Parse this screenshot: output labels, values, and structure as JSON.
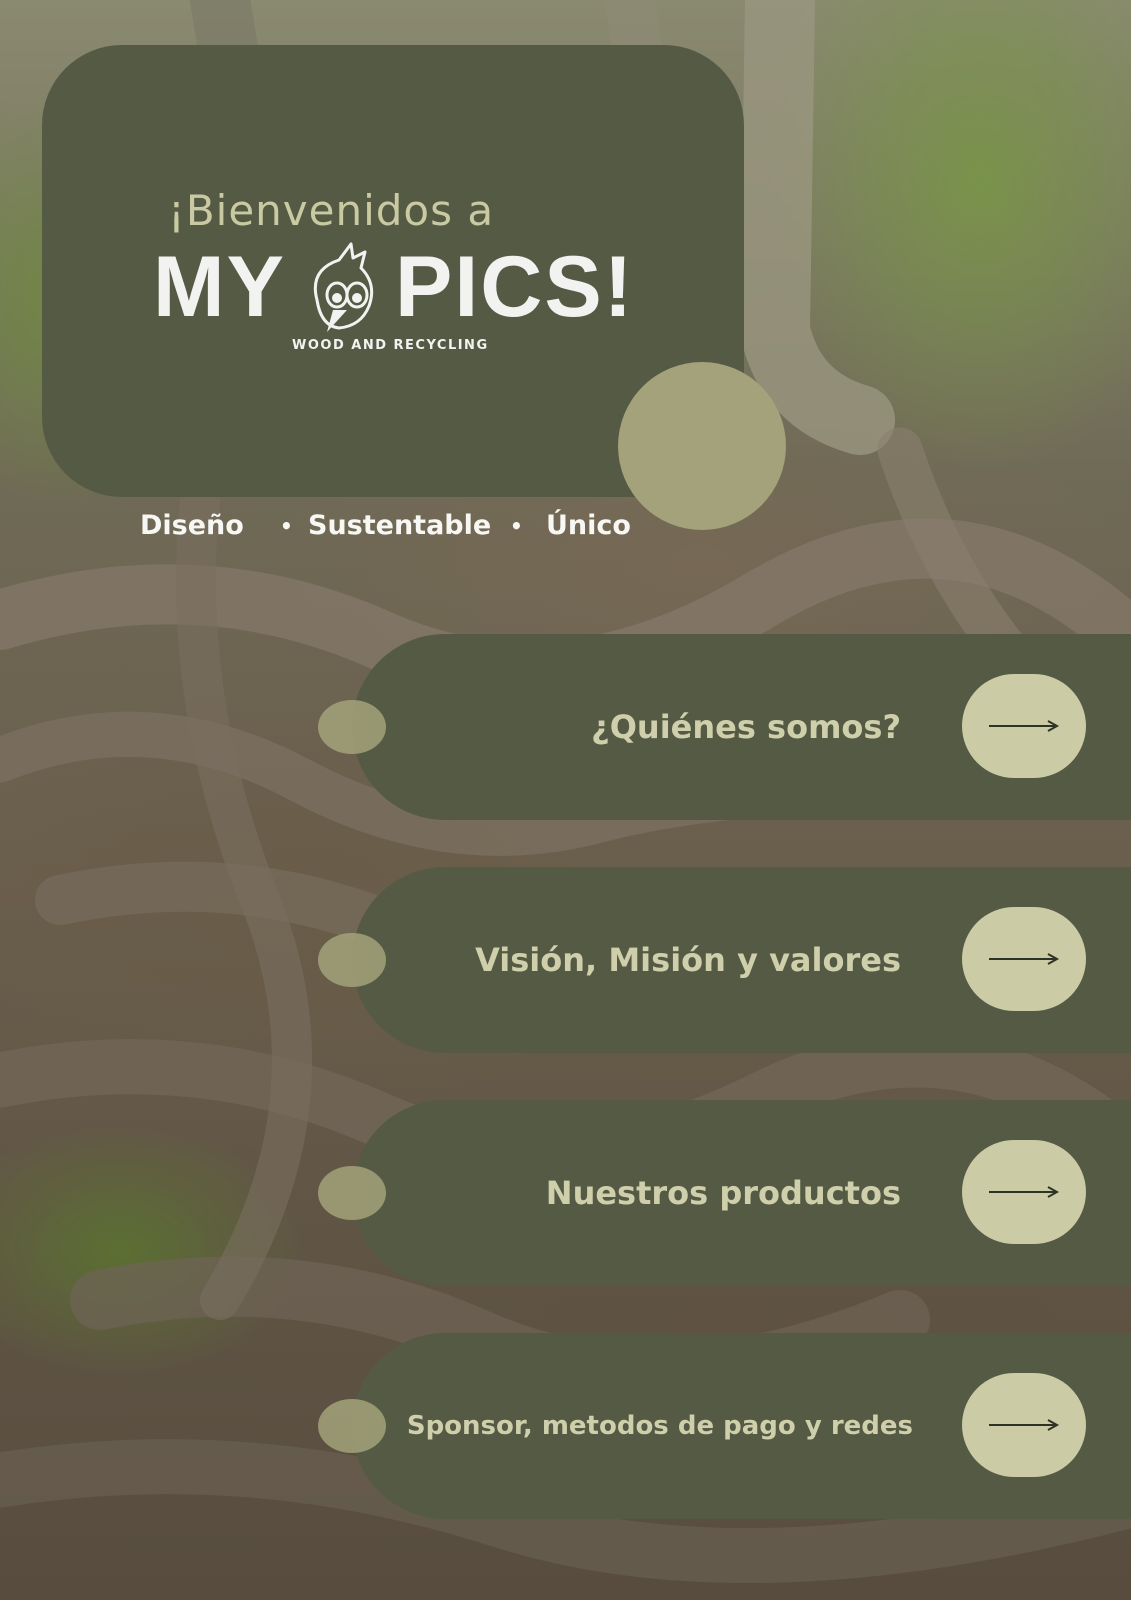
{
  "hero": {
    "welcome": "¡Bienvenidos a",
    "brand_left": "MY",
    "brand_right": "PICS!",
    "tagline": "WOOD AND RECYCLING"
  },
  "values": {
    "item1": "Diseño",
    "sep1": "•",
    "item2": "Sustentable",
    "sep2": "•",
    "item3": "Único"
  },
  "nav": [
    {
      "label": "¿Quiénes somos?",
      "icon": "arrow-right-icon"
    },
    {
      "label": "Visión, Misión y valores",
      "icon": "arrow-right-icon"
    },
    {
      "label": "Nuestros productos",
      "icon": "arrow-right-icon"
    },
    {
      "label": "Sponsor, metodos de pago y redes",
      "icon": "arrow-right-icon"
    }
  ],
  "colors": {
    "panel": "#555a45",
    "accent": "#a3a27a",
    "button": "#cbcca6",
    "text_light": "#cfcfab"
  }
}
